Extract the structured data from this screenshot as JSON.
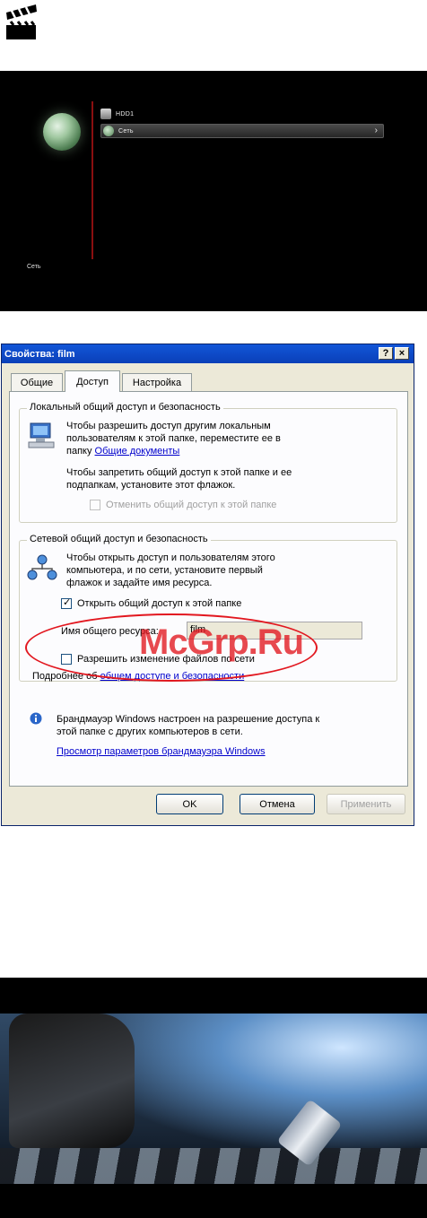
{
  "icons": {
    "clapper": "clapperboard-icon",
    "globe": "globe-icon",
    "hdd": "hard-drive-icon",
    "network": "network-icon",
    "share": "shared-computer-icon",
    "info": "info-icon"
  },
  "player": {
    "items": [
      {
        "label": "HDD1"
      },
      {
        "label": "Сеть"
      }
    ],
    "footer_label": "Сеть"
  },
  "dialog": {
    "title": "Свойства: film",
    "help_label": "?",
    "close_label": "×",
    "tabs": [
      {
        "label": "Общие"
      },
      {
        "label": "Доступ"
      },
      {
        "label": "Настройка"
      }
    ],
    "local_group": {
      "title": "Локальный общий доступ и безопасность",
      "text1_line1": "Чтобы разрешить доступ другим локальным",
      "text1_line2": "пользователям к этой папке, переместите ее в",
      "text1_line3_prefix": "папку ",
      "text1_link": "Общие документы",
      "text2_line1": "Чтобы запретить общий доступ к этой папке и ее",
      "text2_line2": "подпапкам, установите этот флажок.",
      "checkbox_label": "Отменить общий доступ к этой папке"
    },
    "net_group": {
      "title": "Сетевой общий доступ и безопасность",
      "text_line1": "Чтобы открыть доступ и пользователям этого",
      "text_line2": "компьютера, и по сети, установите первый",
      "text_line3": "флажок и задайте имя ресурса.",
      "share_checkbox_label": "Открыть общий доступ к этой папке",
      "share_name_label": "Имя общего ресурса:",
      "share_name_value": "film",
      "write_checkbox_label": "Разрешить изменение файлов по сети",
      "more_prefix": "Подробнее об ",
      "more_link": "общем доступе и безопасности"
    },
    "firewall": {
      "line1": "Брандмауэр Windows настроен на разрешение доступа к",
      "line2": "этой папке с других компьютеров в сети.",
      "link": "Просмотр параметров брандмауэра Windows"
    },
    "buttons": {
      "ok": "OK",
      "cancel": "Отмена",
      "apply": "Применить"
    }
  },
  "watermark": "McGrp.Ru"
}
